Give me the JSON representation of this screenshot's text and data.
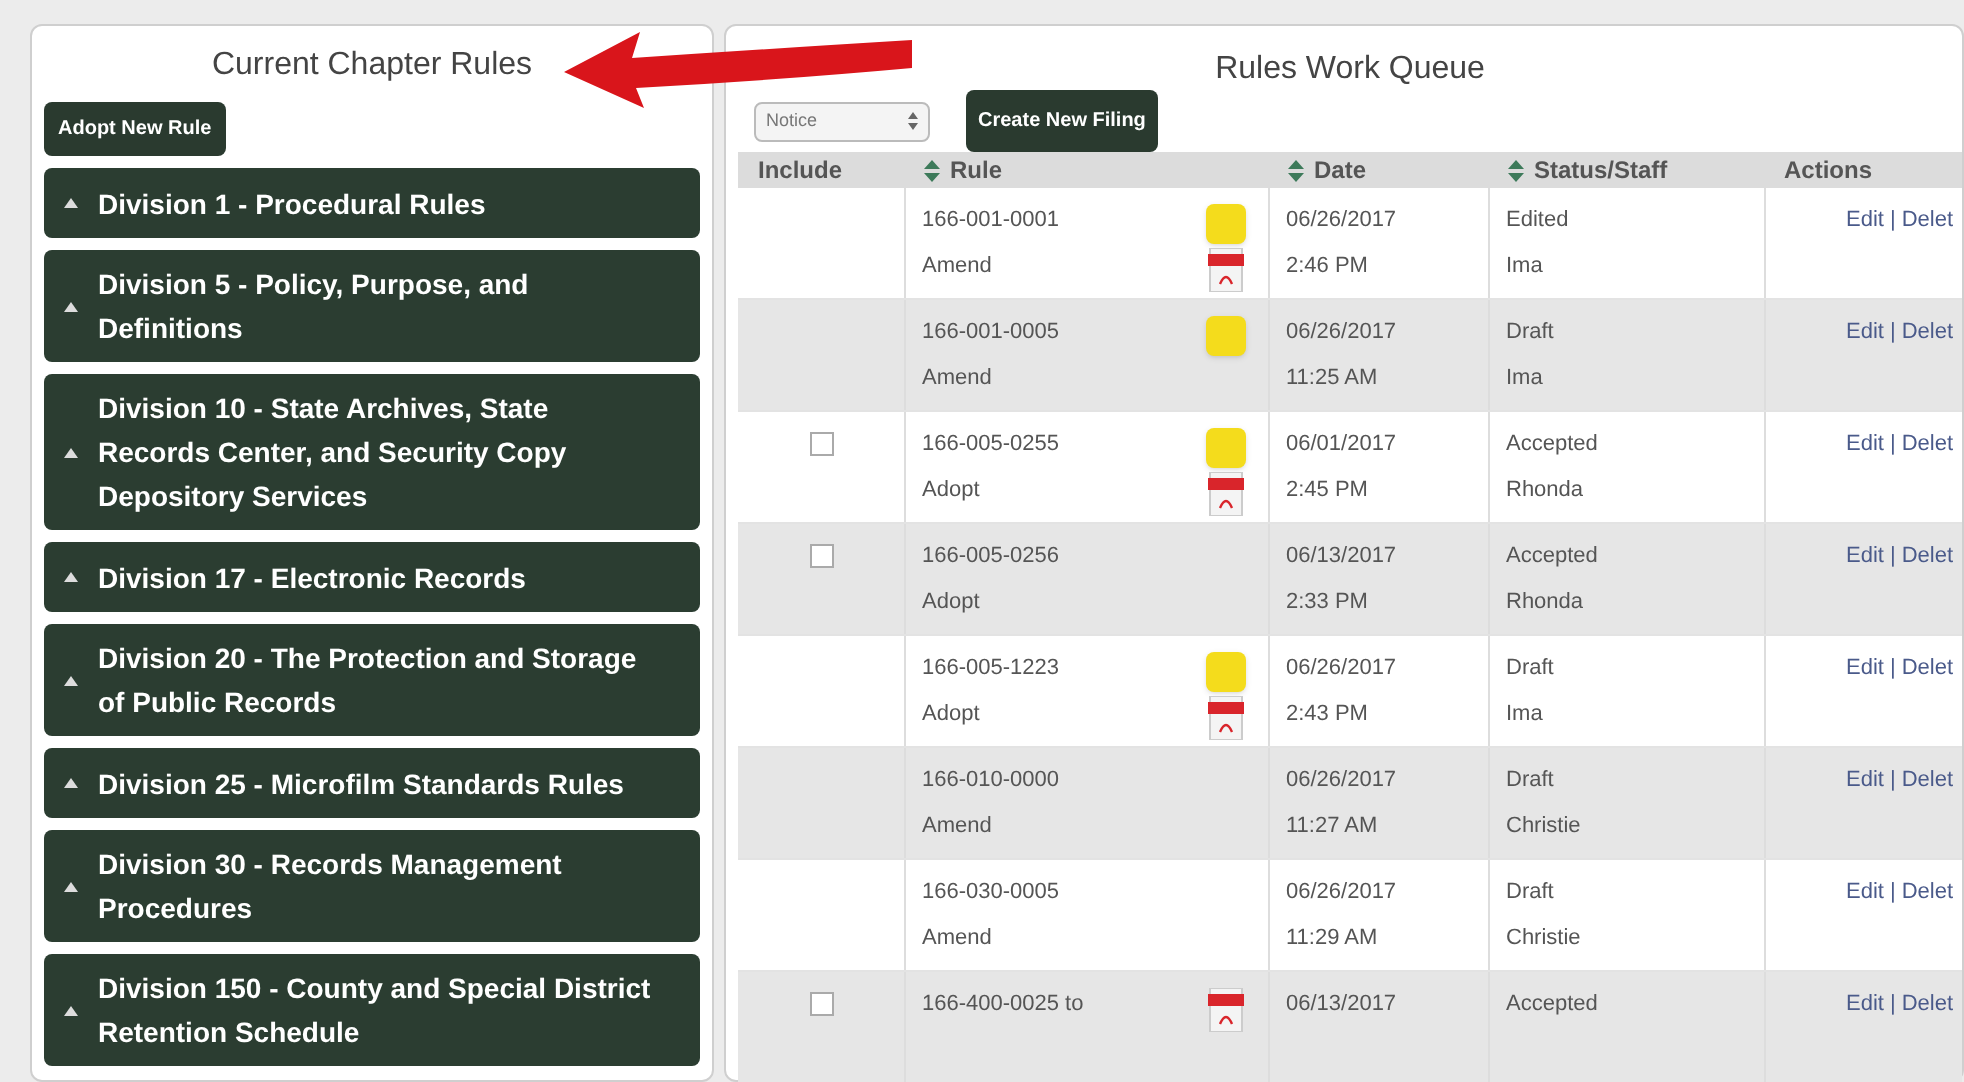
{
  "left_panel": {
    "title": "Current Chapter Rules",
    "adopt_button": "Adopt New Rule",
    "divisions": [
      {
        "label": "Division 1 - Procedural Rules",
        "expanded": false
      },
      {
        "label": "Division 5 - Policy, Purpose, and Definitions",
        "expanded": false
      },
      {
        "label": "Division 10 - State Archives, State Records Center, and Security Copy Depository Services",
        "expanded": false
      },
      {
        "label": "Division 17 - Electronic Records",
        "expanded": false
      },
      {
        "label": "Division 20 - The Protection and Storage of Public Records",
        "expanded": false
      },
      {
        "label": "Division 25 - Microfilm Standards Rules",
        "expanded": false
      },
      {
        "label": "Division 30 - Records Management Procedures",
        "expanded": false
      },
      {
        "label": "Division 150 - County and Special District Retention Schedule",
        "expanded": false
      }
    ]
  },
  "right_panel": {
    "title": "Rules Work Queue",
    "filter_select": "Notice",
    "create_button": "Create New Filing",
    "table": {
      "columns": [
        {
          "label": "Include",
          "sortable": false
        },
        {
          "label": "Rule",
          "sortable": true
        },
        {
          "label": "Date",
          "sortable": true
        },
        {
          "label": "Status/Staff",
          "sortable": true
        },
        {
          "label": "Actions",
          "sortable": false
        }
      ],
      "rows": [
        {
          "rule": "166-001-0001",
          "action": "Amend",
          "note": true,
          "pdf": true,
          "date": "06/26/2017",
          "time": "2:46 PM",
          "status": "Edited",
          "staff": "Ima",
          "include": false,
          "edit": "Edit",
          "separator": "|",
          "delete": "Delet"
        },
        {
          "rule": "166-001-0005",
          "action": "Amend",
          "note": true,
          "pdf": false,
          "date": "06/26/2017",
          "time": "11:25 AM",
          "status": "Draft",
          "staff": "Ima",
          "include": false,
          "edit": "Edit",
          "separator": "|",
          "delete": "Delet"
        },
        {
          "rule": "166-005-0255",
          "action": "Adopt",
          "note": true,
          "pdf": true,
          "date": "06/01/2017",
          "time": "2:45 PM",
          "status": "Accepted",
          "staff": "Rhonda",
          "include": true,
          "checked": false,
          "edit": "Edit",
          "separator": "|",
          "delete": "Delet"
        },
        {
          "rule": "166-005-0256",
          "action": "Adopt",
          "note": false,
          "pdf": false,
          "date": "06/13/2017",
          "time": "2:33 PM",
          "status": "Accepted",
          "staff": "Rhonda",
          "include": true,
          "checked": false,
          "edit": "Edit",
          "separator": "|",
          "delete": "Delet"
        },
        {
          "rule": "166-005-1223",
          "action": "Adopt",
          "note": true,
          "pdf": true,
          "date": "06/26/2017",
          "time": "2:43 PM",
          "status": "Draft",
          "staff": "Ima",
          "include": false,
          "edit": "Edit",
          "separator": "|",
          "delete": "Delet"
        },
        {
          "rule": "166-010-0000",
          "action": "Amend",
          "note": false,
          "pdf": false,
          "date": "06/26/2017",
          "time": "11:27 AM",
          "status": "Draft",
          "staff": "Christie",
          "include": false,
          "edit": "Edit",
          "separator": "|",
          "delete": "Delet"
        },
        {
          "rule": "166-030-0005",
          "action": "Amend",
          "note": false,
          "pdf": false,
          "date": "06/26/2017",
          "time": "11:29 AM",
          "status": "Draft",
          "staff": "Christie",
          "include": false,
          "edit": "Edit",
          "separator": "|",
          "delete": "Delet"
        },
        {
          "rule": "166-400-0025 to",
          "note": false,
          "pdf": true,
          "date": "06/13/2017",
          "status": "Accepted",
          "include": true,
          "checked": false,
          "edit": "Edit",
          "separator": "|",
          "delete": "Delet"
        }
      ]
    }
  }
}
